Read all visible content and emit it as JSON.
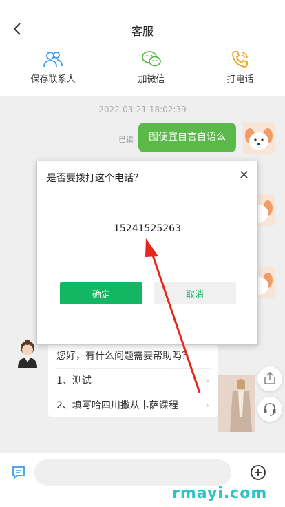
{
  "header": {
    "title": "客服",
    "actions": [
      {
        "label": "保存联系人",
        "icon": "contacts-icon"
      },
      {
        "label": "加微信",
        "icon": "wechat-icon"
      },
      {
        "label": "打电话",
        "icon": "phone-icon"
      }
    ]
  },
  "chat": {
    "timestamp": "2022-03-21 18:02:39",
    "read_status": "已读",
    "outgoing_message": "图便宜自言自语么",
    "agent_card": {
      "greeting": "您好，有什么问题需要帮助吗？",
      "faq": [
        "1、测试",
        "2、填写哈四川撒从卡萨课程"
      ]
    }
  },
  "dialog": {
    "title": "是否要拨打这个电话？",
    "phone": "15241525263",
    "confirm_label": "确定",
    "cancel_label": "取消"
  },
  "footer": {
    "input_placeholder": ""
  },
  "watermark": "rmayi.com",
  "colors": {
    "accent_blue": "#3a9cf0",
    "wechat_green": "#5bb94a",
    "phone_orange": "#f0a020",
    "confirm_green": "#13b663",
    "arrow_red": "#e8261c"
  }
}
